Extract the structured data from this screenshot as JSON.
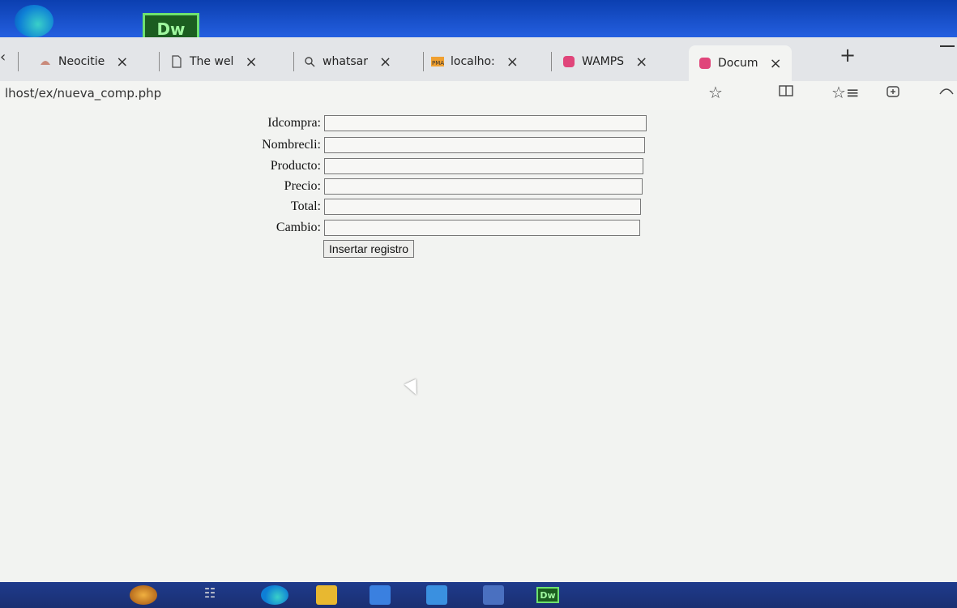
{
  "os_top": {
    "app_badge": "Dw"
  },
  "tabs": [
    {
      "label": "Neocitie",
      "close": "×"
    },
    {
      "label": "The wel",
      "close": "×"
    },
    {
      "label": "whatsar",
      "close": "×"
    },
    {
      "label": "localho:",
      "close": "×"
    },
    {
      "label": "WAMPS",
      "close": "×"
    },
    {
      "label": "Docum",
      "close": "×"
    }
  ],
  "new_tab": "+",
  "address": {
    "url": "lhost/ex/nueva_comp.php"
  },
  "form": {
    "fields": [
      {
        "label": "Idcompra:",
        "value": ""
      },
      {
        "label": "Nombrecli:",
        "value": ""
      },
      {
        "label": "Producto:",
        "value": ""
      },
      {
        "label": "Precio:",
        "value": ""
      },
      {
        "label": "Total:",
        "value": ""
      },
      {
        "label": "Cambio:",
        "value": ""
      }
    ],
    "submit_label": "Insertar registro"
  },
  "taskbar": {
    "dw_label": "Dw"
  }
}
